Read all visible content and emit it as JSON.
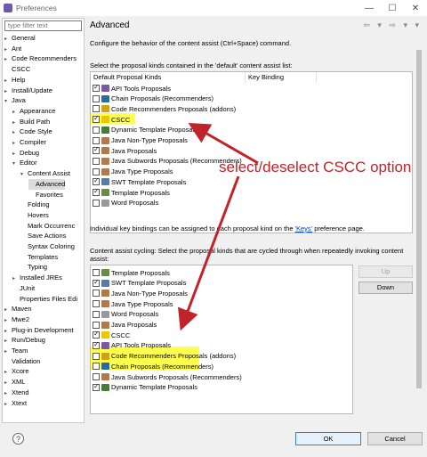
{
  "window": {
    "title": "Preferences",
    "minimize": "—",
    "maximize": "☐",
    "close": "✕"
  },
  "filter": {
    "placeholder": "type filter text"
  },
  "tree": [
    {
      "label": "General",
      "exp": "▸"
    },
    {
      "label": "Ant",
      "exp": "▸"
    },
    {
      "label": "Code Recommenders",
      "exp": "▸"
    },
    {
      "label": "CSCC",
      "exp": ""
    },
    {
      "label": "Help",
      "exp": "▸"
    },
    {
      "label": "Install/Update",
      "exp": "▸"
    },
    {
      "label": "Java",
      "exp": "▾"
    },
    {
      "label": "Appearance",
      "exp": "▸"
    },
    {
      "label": "Build Path",
      "exp": "▸"
    },
    {
      "label": "Code Style",
      "exp": "▸"
    },
    {
      "label": "Compiler",
      "exp": "▸"
    },
    {
      "label": "Debug",
      "exp": "▸"
    },
    {
      "label": "Editor",
      "exp": "▾"
    },
    {
      "label": "Content Assist",
      "exp": "▾"
    },
    {
      "label": "Advanced",
      "exp": ""
    },
    {
      "label": "Favorites",
      "exp": ""
    },
    {
      "label": "Folding",
      "exp": ""
    },
    {
      "label": "Hovers",
      "exp": ""
    },
    {
      "label": "Mark Occurrenc",
      "exp": ""
    },
    {
      "label": "Save Actions",
      "exp": ""
    },
    {
      "label": "Syntax Coloring",
      "exp": ""
    },
    {
      "label": "Templates",
      "exp": ""
    },
    {
      "label": "Typing",
      "exp": ""
    },
    {
      "label": "Installed JREs",
      "exp": "▸"
    },
    {
      "label": "JUnit",
      "exp": ""
    },
    {
      "label": "Properties Files Edi",
      "exp": ""
    },
    {
      "label": "Maven",
      "exp": "▸"
    },
    {
      "label": "Mwe2",
      "exp": "▸"
    },
    {
      "label": "Plug-in Development",
      "exp": "▸"
    },
    {
      "label": "Run/Debug",
      "exp": "▸"
    },
    {
      "label": "Team",
      "exp": "▸"
    },
    {
      "label": "Validation",
      "exp": ""
    },
    {
      "label": "Xcore",
      "exp": "▸"
    },
    {
      "label": "XML",
      "exp": "▸"
    },
    {
      "label": "Xtend",
      "exp": "▸"
    },
    {
      "label": "Xtext",
      "exp": "▸"
    }
  ],
  "page": {
    "title": "Advanced",
    "nav": "⇦ ▾ ⇨ ▾ ▾",
    "description": "Configure the behavior of the content assist (Ctrl+Space) command.",
    "default_label": "Select the proposal kinds contained in the 'default' content assist list:",
    "col1": "Default Proposal Kinds",
    "col2": "Key Binding",
    "keys_note_pre": "Individual key bindings can be assigned to each proposal kind on the ",
    "keys_link": "'Keys'",
    "keys_note_post": " preference page.",
    "cycling_label_1": "Content assist cycling: Select the proposal kinds that are cycled through when repeatedly invoking content",
    "cycling_label_2": "assist:",
    "up": "Up",
    "down": "Down",
    "ok": "OK",
    "cancel": "Cancel",
    "help_icon": "?"
  },
  "default_list": [
    {
      "label": "API Tools Proposals",
      "checked": true,
      "color": "#7a5aa0"
    },
    {
      "label": "Chain Proposals (Recommenders)",
      "checked": false,
      "color": "#2b6c99"
    },
    {
      "label": "Code Recommenders Proposals (addons)",
      "checked": false,
      "color": "#d4a017"
    },
    {
      "label": "CSCC",
      "checked": true,
      "color": "#e8c800"
    },
    {
      "label": "Dynamic Template Proposals",
      "checked": false,
      "color": "#4a7a3a"
    },
    {
      "label": "Java Non-Type Proposals",
      "checked": false,
      "color": "#b07a4a"
    },
    {
      "label": "Java Proposals",
      "checked": true,
      "color": "#b07a4a"
    },
    {
      "label": "Java Subwords Proposals (Recommenders)",
      "checked": false,
      "color": "#b07a4a"
    },
    {
      "label": "Java Type Proposals",
      "checked": false,
      "color": "#b07a4a"
    },
    {
      "label": "SWT Template Proposals",
      "checked": true,
      "color": "#5a7aa0"
    },
    {
      "label": "Template Proposals",
      "checked": true,
      "color": "#6a8a4a"
    },
    {
      "label": "Word Proposals",
      "checked": false,
      "color": "#999999"
    }
  ],
  "cycling_list": [
    {
      "label": "Template Proposals",
      "checked": false,
      "color": "#6a8a4a"
    },
    {
      "label": "SWT Template Proposals",
      "checked": true,
      "color": "#5a7aa0"
    },
    {
      "label": "Java Non-Type Proposals",
      "checked": false,
      "color": "#b07a4a"
    },
    {
      "label": "Java Type Proposals",
      "checked": false,
      "color": "#b07a4a"
    },
    {
      "label": "Word Proposals",
      "checked": false,
      "color": "#999999"
    },
    {
      "label": "Java Proposals",
      "checked": false,
      "color": "#b07a4a"
    },
    {
      "label": "CSCC",
      "checked": true,
      "color": "#e8c800"
    },
    {
      "label": "API Tools Proposals",
      "checked": true,
      "color": "#7a5aa0"
    },
    {
      "label": "Code Recommenders Proposals (addons)",
      "checked": false,
      "color": "#d4a017"
    },
    {
      "label": "Chain Proposals (Recommenders)",
      "checked": false,
      "color": "#2b6c99"
    },
    {
      "label": "Java Subwords Proposals (Recommenders)",
      "checked": false,
      "color": "#b07a4a"
    },
    {
      "label": "Dynamic Template Proposals",
      "checked": true,
      "color": "#4a7a3a"
    }
  ],
  "annotation": {
    "text": "select/deselect CSCC option",
    "color": "#c0232a"
  }
}
